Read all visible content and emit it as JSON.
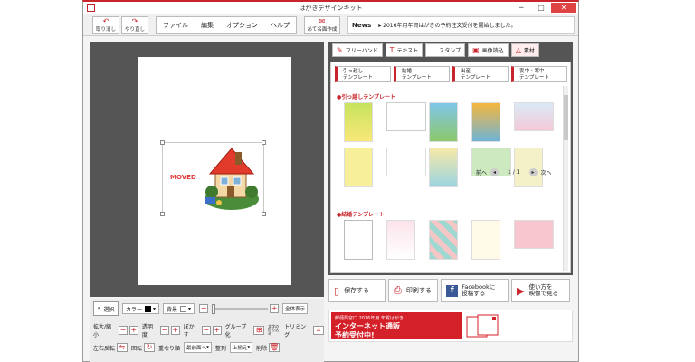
{
  "window": {
    "title": "はがきデザインキット",
    "controls": {
      "minimize": "─",
      "maximize": "□",
      "close": "✕"
    }
  },
  "toolbar": {
    "undo_label": "取り消し",
    "redo_label": "やり直し",
    "menu": [
      "ファイル",
      "編集",
      "オプション",
      "ヘルプ"
    ],
    "envelope_label": "あて名面作成",
    "news_label": "News",
    "news_text": "▸ 2016年用年賀はがきの予約注文受付を開始しました。"
  },
  "canvas": {
    "photo_text": "MOVED"
  },
  "tools": {
    "select_label": "選択",
    "color_label": "カラー",
    "background_label": "背景",
    "fullview_label": "全体表示",
    "zoom_label": "拡大/縮小",
    "opacity_label": "透明度",
    "blur_label": "ぼかす",
    "group_label": "グループ化",
    "text_wrap_label": "文字の回り込み",
    "trim_label": "トリミング",
    "flip_label": "左右反転",
    "rotate_label": "回転",
    "order_label": "重なり順",
    "front_label": "最前面へ",
    "align_label": "整列",
    "align_top_label": "上揃え",
    "delete_label": "削除"
  },
  "side_tabs": [
    "フリーハンド",
    "テキスト",
    "スタンプ",
    "画像読込",
    "素材"
  ],
  "categories": [
    "引っ越し\nテンプレート",
    "結婚\nテンプレート",
    "出産\nテンプレート",
    "喪中・寒中\nテンプレート"
  ],
  "sections": {
    "moving_title": "●引っ越しテンプレート",
    "wedding_title": "●結婚テンプレート"
  },
  "pager": {
    "prev": "前へ",
    "page": "1 / 1",
    "next": "次へ"
  },
  "actions": {
    "save_label": "保存する",
    "print_label": "印刷する",
    "facebook_label": "Facebookに\n投稿する",
    "video_label": "使い方を\n映像で見る"
  },
  "banner": {
    "line1": "郵便局窓口 2016年用 年賀はがき",
    "line2": "インターネット通販",
    "line3": "予約受付中!"
  },
  "colors": {
    "accent": "#c8242b",
    "canvas_bg": "#555555",
    "facebook": "#3b5998"
  }
}
